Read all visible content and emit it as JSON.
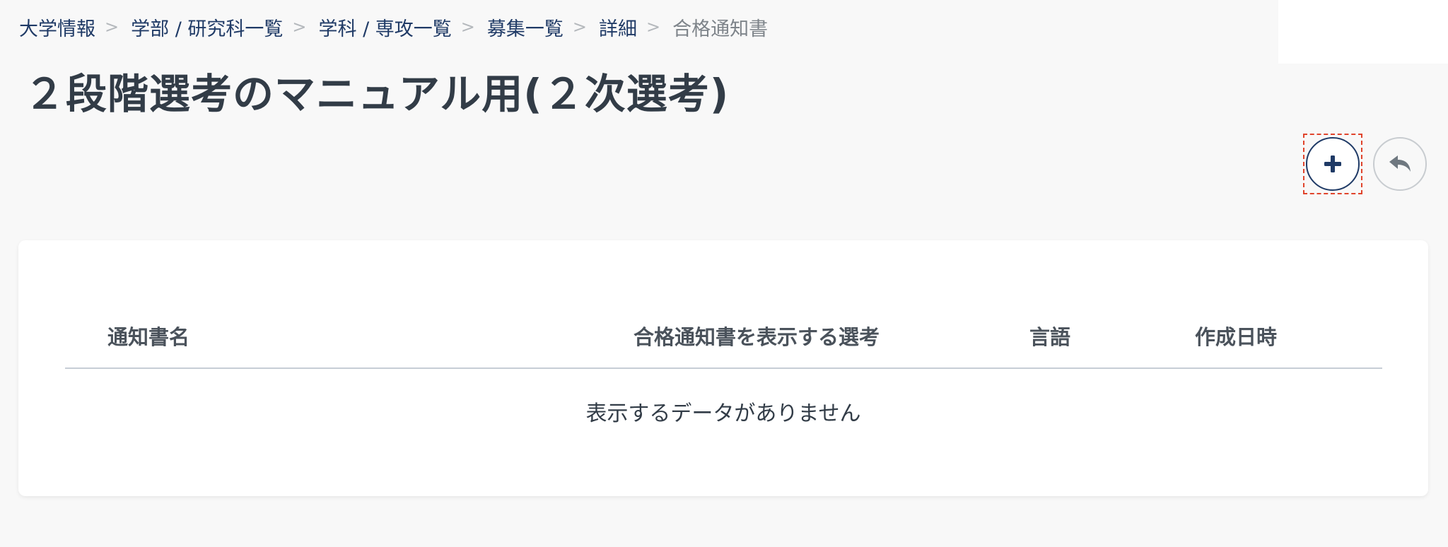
{
  "breadcrumb": {
    "items": [
      {
        "label": "大学情報"
      },
      {
        "label": "学部 / 研究科一覧"
      },
      {
        "label": "学科 / 専攻一覧"
      },
      {
        "label": "募集一覧"
      },
      {
        "label": "詳細"
      },
      {
        "label": "合格通知書"
      }
    ],
    "separator": ">"
  },
  "page": {
    "title": "２段階選考のマニュアル用(２次選考)"
  },
  "toolbar": {
    "add_icon": "plus-icon",
    "back_icon": "reply-arrow-icon"
  },
  "table": {
    "columns": [
      "通知書名",
      "合格通知書を表示する選考",
      "言語",
      "作成日時"
    ],
    "rows": [],
    "empty_message": "表示するデータがありません"
  },
  "colors": {
    "background": "#f8f8f8",
    "link": "#1f3a66",
    "title": "#323c47",
    "focus_outline": "#e0442c"
  }
}
